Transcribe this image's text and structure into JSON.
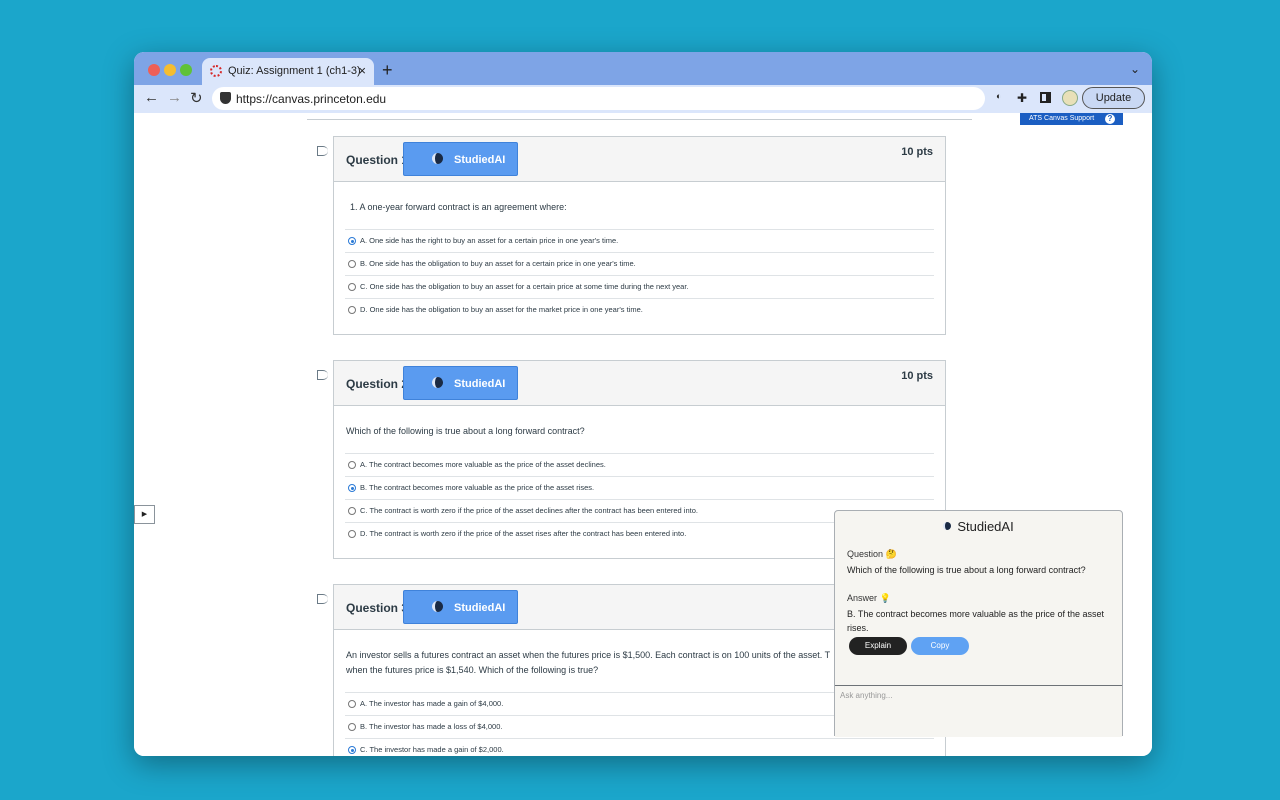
{
  "browser": {
    "tab_title": "Quiz: Assignment 1 (ch1-3)",
    "tab_close": "×",
    "new_tab": "+",
    "tab_menu": "⌄",
    "back": "←",
    "forward": "→",
    "reload": "↻",
    "url": "https://canvas.princeton.edu",
    "update_label": "Update"
  },
  "canvas": {
    "support_label": "ATS Canvas Support",
    "support_help": "?",
    "sidebar_toggle": "▶"
  },
  "studied_button_label": "StudiedAI",
  "questions": [
    {
      "title": "Question 1",
      "points": "10 pts",
      "prompt": "1. A one-year forward contract is an agreement where:",
      "answers": [
        {
          "text": "A. One side has the right to buy an asset for a certain price in one year's time.",
          "selected": true
        },
        {
          "text": "B. One side has the obligation to buy an asset for a certain price in one year's time.",
          "selected": false
        },
        {
          "text": "C. One side has the obligation to buy an asset for a certain price at some time during the next year.",
          "selected": false
        },
        {
          "text": "D. One side has the obligation to buy an asset for the market price in one year's time.",
          "selected": false
        }
      ]
    },
    {
      "title": "Question 2",
      "points": "10 pts",
      "prompt": "Which of the following is true about a long forward contract?",
      "answers": [
        {
          "text": "A. The contract becomes more valuable as the price of the asset declines.",
          "selected": false
        },
        {
          "text": "B. The contract becomes more valuable as the price of the asset rises.",
          "selected": true
        },
        {
          "text": "C. The contract is worth zero if the price of the asset declines after the contract has been entered into.",
          "selected": false
        },
        {
          "text": "D. The contract is worth zero if the price of the asset rises after the contract has been entered into.",
          "selected": false
        }
      ]
    },
    {
      "title": "Question 3",
      "prompt_line1": "An investor sells a futures contract an asset when the futures price is $1,500. Each contract is on 100 units of the asset. T",
      "prompt_line2": "when the futures price is $1,540. Which of the following is true?",
      "answers": [
        {
          "text": "A. The investor has made a gain of $4,000.",
          "selected": false
        },
        {
          "text": "B. The investor has made a loss of $4,000.",
          "selected": false
        },
        {
          "text": "C. The investor has made a gain of $2,000.",
          "selected": true
        }
      ]
    }
  ],
  "panel": {
    "title": "StudiedAI",
    "question_label": "Question 🤔",
    "question_text": "Which of the following is true about a long forward contract?",
    "answer_label": "Answer 💡",
    "answer_text": "B. The contract becomes more valuable as the price of the asset rises.",
    "explain_label": "Explain",
    "copy_label": "Copy",
    "input_placeholder": "Ask anything..."
  }
}
